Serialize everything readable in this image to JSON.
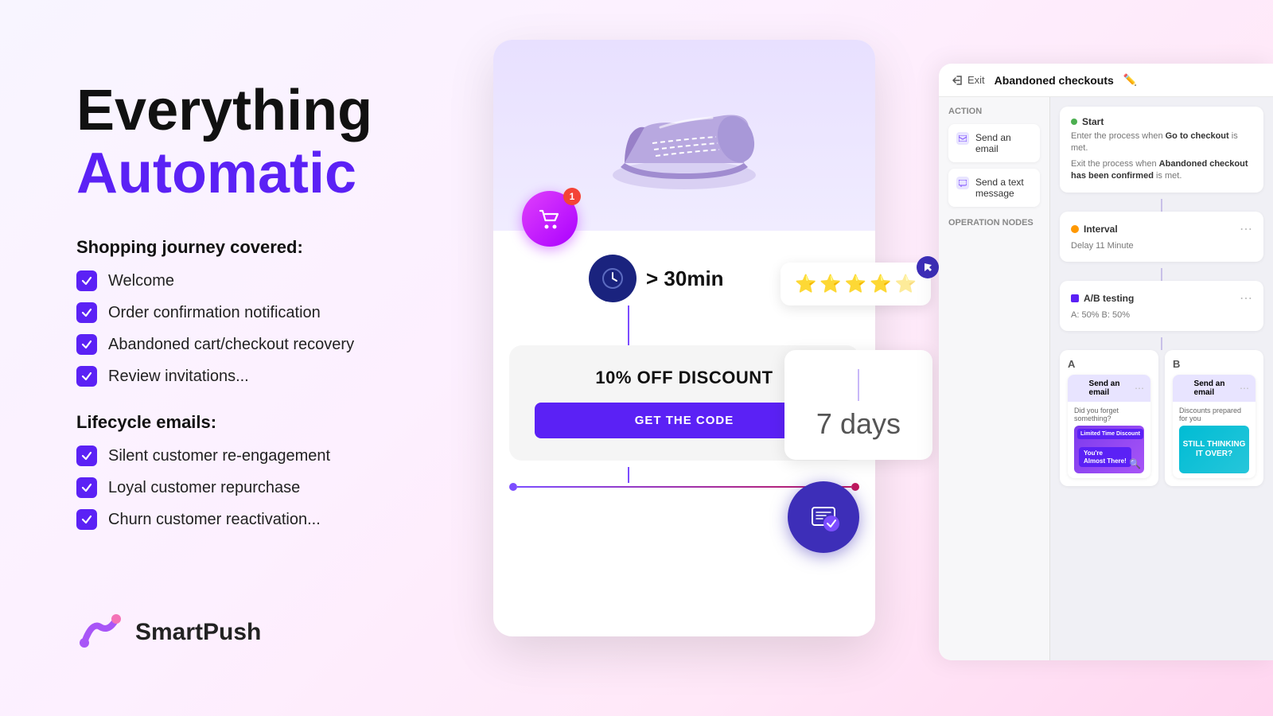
{
  "page": {
    "title": "SmartPush - Everything Automatic"
  },
  "hero": {
    "line1": "Everything ",
    "line2": "Automatic"
  },
  "shopping_section": {
    "label": "Shopping journey covered:",
    "items": [
      "Welcome",
      "Order confirmation notification",
      "Abandoned cart/checkout recovery",
      "Review invitations..."
    ]
  },
  "lifecycle_section": {
    "label": "Lifecycle emails:",
    "items": [
      "Silent customer re-engagement",
      "Loyal customer repurchase",
      "Churn customer reactivation..."
    ]
  },
  "logo": {
    "name": "SmartPush"
  },
  "center_card": {
    "timer_text": "> 30min",
    "discount_title": "10% OFF DISCOUNT",
    "get_code_btn": "GET THE CODE",
    "days_label": "7 days",
    "badge": "1"
  },
  "workflow_panel": {
    "exit_label": "Exit",
    "title": "Abandoned checkouts",
    "action_section": "Action",
    "actions": [
      {
        "label": "Send an email"
      },
      {
        "label": "Send a text message"
      }
    ],
    "operation_section": "Operation nodes",
    "wf_nodes": [
      {
        "type": "start",
        "label": "Start",
        "sub1": "Enter the process when Go to checkout is met.",
        "sub2": "Exit the process when Abandoned checkout has been confirmed is met."
      },
      {
        "type": "interval",
        "label": "Interval",
        "sub": "Delay 11 Minute"
      },
      {
        "type": "ab",
        "label": "A/B testing",
        "sub": "A: 50%  B: 50%"
      },
      {
        "col_a_label": "A",
        "col_b_label": "B",
        "email_a": {
          "header": "Send an email",
          "sub": "Did you forget something?",
          "img_text": "You're\nAlmost There!",
          "tag": "Limited Time Discount"
        },
        "email_b": {
          "header": "Send an email",
          "sub": "Discounts prepared for you",
          "img_text": "STILL\nTHINKING IT\nOVER?"
        }
      }
    ]
  },
  "stars": {
    "filled": 4,
    "half": 1
  }
}
